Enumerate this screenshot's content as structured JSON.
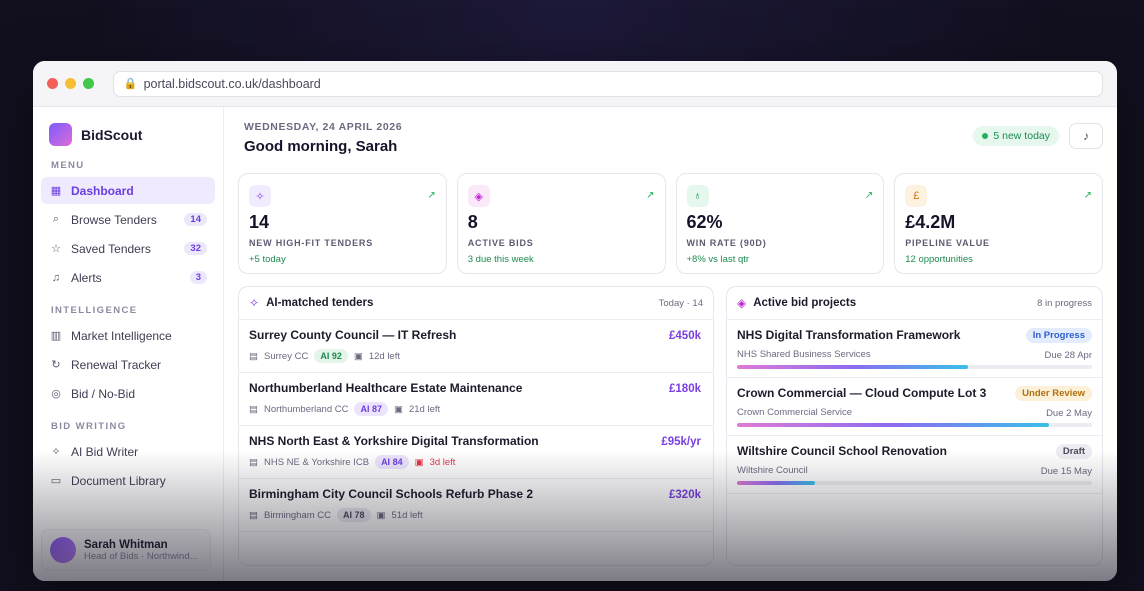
{
  "browser": {
    "url": "portal.bidscout.co.uk/dashboard"
  },
  "sidebar": {
    "brand": "BidScout",
    "sections": {
      "menu": "MENU",
      "intelligence": "INTELLIGENCE",
      "bid_writing": "BID WRITING"
    },
    "menu_items": [
      {
        "label": "Dashboard",
        "badge": "",
        "icon": "dashboard-icon"
      },
      {
        "label": "Browse Tenders",
        "badge": "14",
        "icon": "search-icon"
      },
      {
        "label": "Saved Tenders",
        "badge": "32",
        "icon": "star-icon"
      },
      {
        "label": "Alerts",
        "badge": "3",
        "icon": "bell-icon"
      }
    ],
    "intelligence_items": [
      {
        "label": "Market Intelligence",
        "icon": "bar-chart-icon"
      },
      {
        "label": "Renewal Tracker",
        "icon": "refresh-icon"
      },
      {
        "label": "Bid / No-Bid",
        "icon": "target-icon"
      }
    ],
    "bid_writing_items": [
      {
        "label": "AI Bid Writer",
        "icon": "sparkle-icon"
      },
      {
        "label": "Document Library",
        "icon": "folder-icon"
      }
    ],
    "user": {
      "name": "Sarah Whitman",
      "role": "Head of Bids · Northwind..."
    }
  },
  "header": {
    "date": "WEDNESDAY, 24 APRIL 2026",
    "greeting": "Good morning, Sarah",
    "new_today": "5 new today"
  },
  "stats": [
    {
      "value": "14",
      "label": "NEW HIGH-FIT TENDERS",
      "sub": "+5 today",
      "icon": "sparkle-icon",
      "color": "#7c3aed"
    },
    {
      "value": "8",
      "label": "ACTIVE BIDS",
      "sub": "3 due this week",
      "icon": "tag-icon",
      "color": "#c026d3"
    },
    {
      "value": "62%",
      "label": "WIN RATE (90D)",
      "sub": "+8% vs last qtr",
      "icon": "award-icon",
      "color": "#16a34a"
    },
    {
      "value": "£4.2M",
      "label": "PIPELINE VALUE",
      "sub": "12 opportunities",
      "icon": "pound-icon",
      "color": "#d97706"
    }
  ],
  "tenders": {
    "title": "AI-matched tenders",
    "meta": "Today · 14",
    "rows": [
      {
        "title": "Surrey County Council — IT Refresh",
        "amount": "£450k",
        "org": "Surrey CC",
        "score": "AI 92",
        "deadline": "12d left",
        "urgent": false
      },
      {
        "title": "Northumberland Healthcare Estate Maintenance",
        "amount": "£180k",
        "org": "Northumberland CC",
        "score": "AI 87",
        "deadline": "21d left",
        "urgent": false
      },
      {
        "title": "NHS North East & Yorkshire Digital Transformation",
        "amount": "£95k/yr",
        "org": "NHS NE & Yorkshire ICB",
        "score": "AI 84",
        "deadline": "3d left",
        "urgent": true
      },
      {
        "title": "Birmingham City Council Schools Refurb Phase 2",
        "amount": "£320k",
        "org": "Birmingham CC",
        "score": "AI 78",
        "deadline": "51d left",
        "urgent": false
      }
    ]
  },
  "projects": {
    "title": "Active bid projects",
    "meta": "8 in progress",
    "rows": [
      {
        "title": "NHS Digital Transformation Framework",
        "status": "In Progress",
        "org": "NHS Shared Business Services",
        "due": "Due 28 Apr",
        "progress": 0.65
      },
      {
        "title": "Crown Commercial — Cloud Compute Lot 3",
        "status": "Under Review",
        "org": "Crown Commercial Service",
        "due": "Due 2 May",
        "progress": 0.88
      },
      {
        "title": "Wiltshire Council School Renovation",
        "status": "Draft",
        "org": "Wiltshire Council",
        "due": "Due 15 May",
        "progress": 0.22
      }
    ]
  }
}
